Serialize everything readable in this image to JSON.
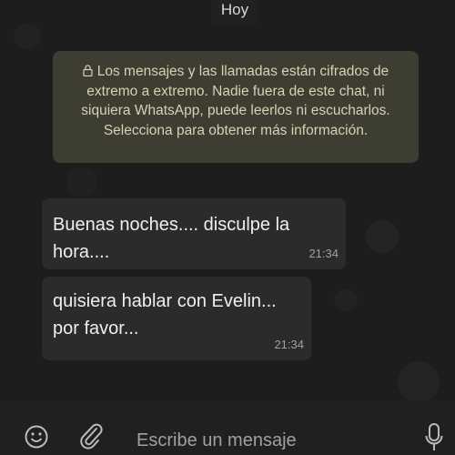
{
  "chat": {
    "date_label": "Hoy",
    "encryption_notice": "Los mensajes y las llamadas están cifrados de extremo a extremo. Nadie fuera de este chat, ni siquiera WhatsApp, puede leerlos ni escucharlos. Selecciona para obtener más información.",
    "messages": [
      {
        "text": "Buenas noches.... disculpe la hora....",
        "time": "21:34"
      },
      {
        "text": "quisiera hablar con Evelin... por favor...",
        "time": "21:34"
      }
    ]
  },
  "composer": {
    "placeholder": "Escribe un mensaje",
    "icons": [
      "emoji-icon",
      "paperclip-icon",
      "microphone-icon"
    ]
  },
  "colors": {
    "background": "#1c1d1c",
    "bubble": "#2a2b2a",
    "notice": "#3e3d31",
    "notice_text": "#d6d2b4"
  }
}
